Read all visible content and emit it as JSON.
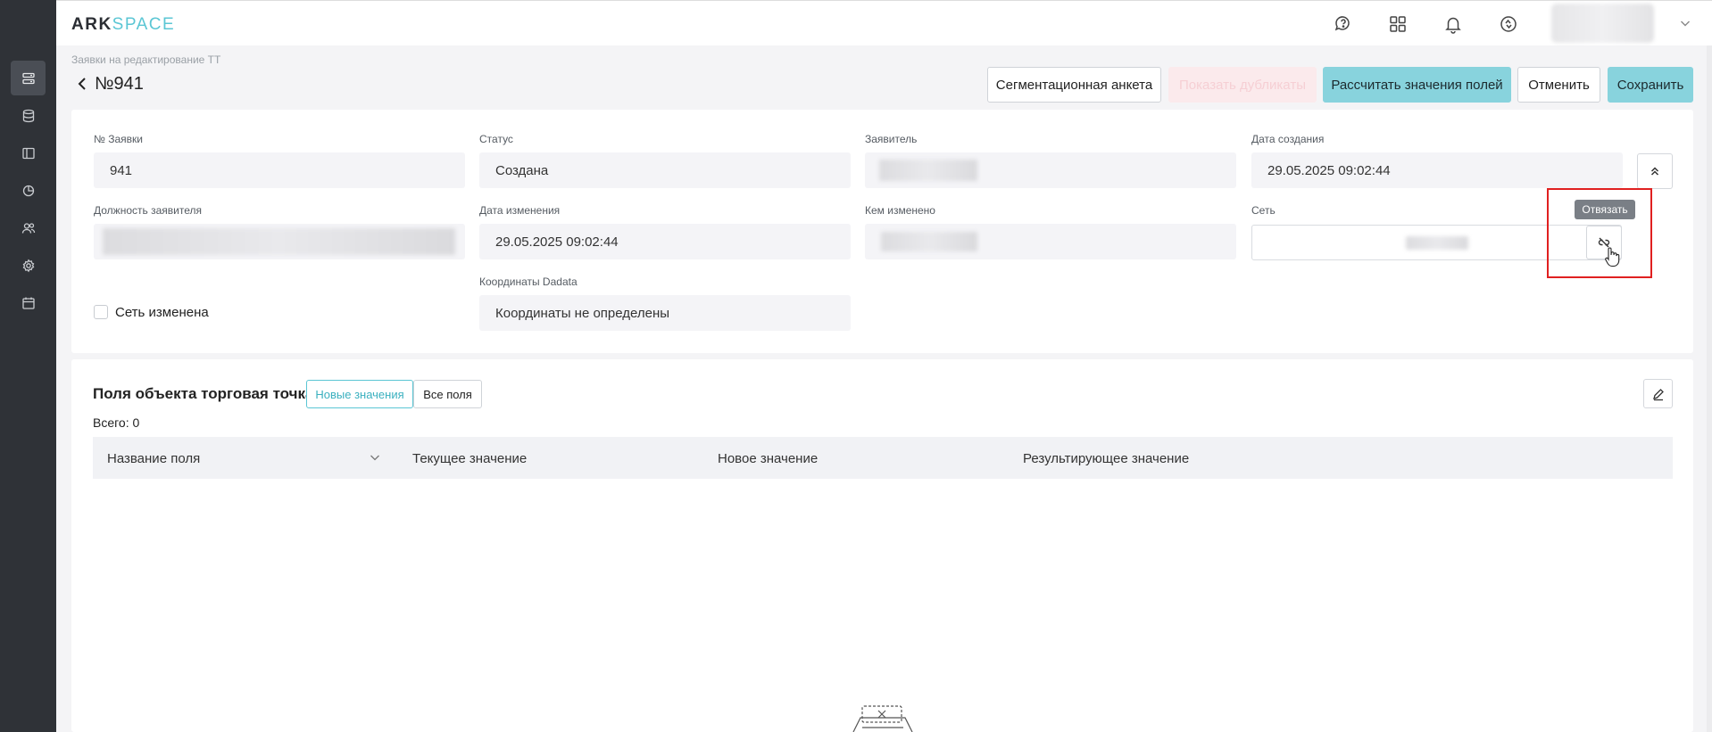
{
  "app": {
    "logo_part1": "ARK",
    "logo_part2": "SPACE"
  },
  "sidebar": {
    "items": [
      {
        "icon": "requests-icon",
        "active": true
      },
      {
        "icon": "database-icon",
        "active": false
      },
      {
        "icon": "layout-icon",
        "active": false
      },
      {
        "icon": "pie-chart-icon",
        "active": false
      },
      {
        "icon": "users-icon",
        "active": false
      },
      {
        "icon": "gear-icon",
        "active": false
      },
      {
        "icon": "calendar-icon",
        "active": false
      }
    ]
  },
  "topbar": {
    "icons": [
      "chat-help-icon",
      "apps-grid-icon",
      "bell-icon",
      "sync-icon"
    ]
  },
  "header": {
    "breadcrumb": "Заявки на редактирование ТТ",
    "title": "№941"
  },
  "toolbar": {
    "segmentation_label": "Сегментационная анкета",
    "duplicates_label": "Показать дубликаты",
    "calculate_label": "Рассчитать значения полей",
    "cancel_label": "Отменить",
    "save_label": "Сохранить"
  },
  "form": {
    "request_no_label": "№ Заявки",
    "request_no_value": "941",
    "status_label": "Статус",
    "status_value": "Создана",
    "applicant_label": "Заявитель",
    "created_label": "Дата создания",
    "created_value": "29.05.2025 09:02:44",
    "position_label": "Должность заявителя",
    "modified_label": "Дата изменения",
    "modified_value": "29.05.2025 09:02:44",
    "modified_by_label": "Кем изменено",
    "network_label": "Сеть",
    "unlink_tooltip": "Отвязать",
    "coords_label": "Координаты Dadata",
    "coords_value": "Координаты не определены",
    "network_changed_label": "Сеть изменена"
  },
  "fields_section": {
    "title": "Поля объекта торговая точка",
    "tab_new": "Новые значения",
    "tab_all": "Все поля",
    "total": "Всего: 0",
    "columns": [
      "Название поля",
      "Текущее значение",
      "Новое значение",
      "Результирующее значение"
    ]
  },
  "colors": {
    "accent": "#5bc6d4",
    "primary_button": "#88d3dd",
    "sidebar_bg": "#2f3237",
    "highlight": "#e02020"
  }
}
